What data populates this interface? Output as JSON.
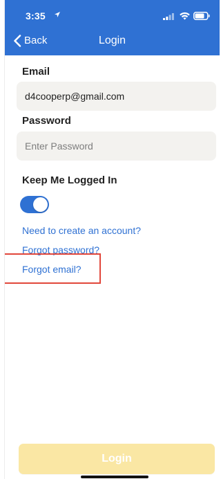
{
  "status_bar": {
    "time": "3:35",
    "icons": [
      "location-arrow-icon",
      "signal-icon",
      "wifi-icon",
      "battery-icon"
    ]
  },
  "nav": {
    "back_label": "Back",
    "title": "Login"
  },
  "form": {
    "email_label": "Email",
    "email_value": "d4cooperp@gmail.com",
    "password_label": "Password",
    "password_placeholder": "Enter Password",
    "keep_logged_in_label": "Keep Me Logged In",
    "keep_logged_in": true
  },
  "links": {
    "create_account": "Need to create an account?",
    "forgot_password": "Forgot password?",
    "forgot_email": "Forgot email?"
  },
  "button": {
    "login_label": "Login"
  },
  "colors": {
    "primary": "#2f71d3",
    "field_background": "#f3f2ef",
    "disabled_button": "#fae7a4",
    "highlight": "#e1463a"
  }
}
